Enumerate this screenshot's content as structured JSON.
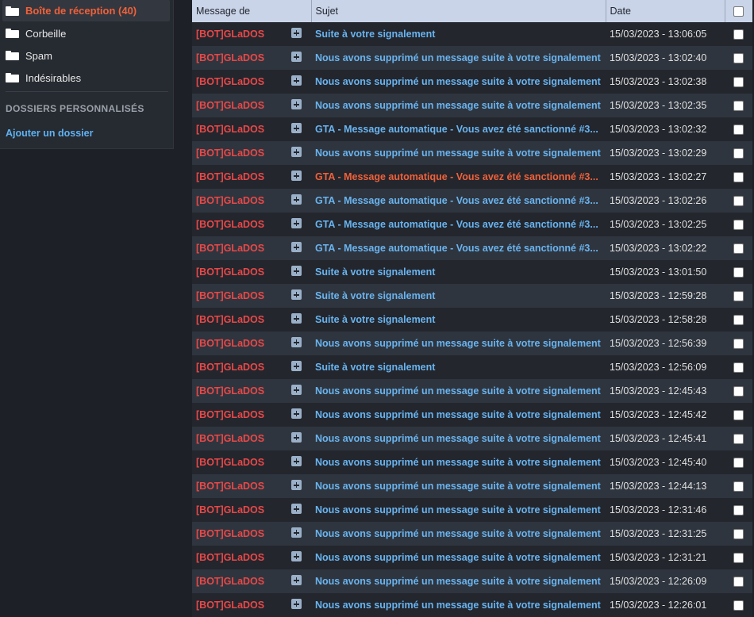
{
  "sidebar": {
    "folders": [
      {
        "label": "Boîte de réception (40)",
        "active": true
      },
      {
        "label": "Corbeille",
        "active": false
      },
      {
        "label": "Spam",
        "active": false
      },
      {
        "label": "Indésirables",
        "active": false
      }
    ],
    "custom_section_title": "DOSSIERS PERSONNALISÉS",
    "add_folder_label": "Ajouter un dossier"
  },
  "table": {
    "headers": {
      "from": "Message de",
      "subject": "Sujet",
      "date": "Date"
    },
    "rows": [
      {
        "from": "[BOT]GLaDOS",
        "subject": "Suite à votre signalement",
        "date": "15/03/2023 - 13:06:05",
        "alert": false
      },
      {
        "from": "[BOT]GLaDOS",
        "subject": "Nous avons supprimé un message suite à votre signalement",
        "date": "15/03/2023 - 13:02:40",
        "alert": false
      },
      {
        "from": "[BOT]GLaDOS",
        "subject": "Nous avons supprimé un message suite à votre signalement",
        "date": "15/03/2023 - 13:02:38",
        "alert": false
      },
      {
        "from": "[BOT]GLaDOS",
        "subject": "Nous avons supprimé un message suite à votre signalement",
        "date": "15/03/2023 - 13:02:35",
        "alert": false
      },
      {
        "from": "[BOT]GLaDOS",
        "subject": "GTA - Message automatique - Vous avez été sanctionné #3...",
        "date": "15/03/2023 - 13:02:32",
        "alert": false
      },
      {
        "from": "[BOT]GLaDOS",
        "subject": "Nous avons supprimé un message suite à votre signalement",
        "date": "15/03/2023 - 13:02:29",
        "alert": false
      },
      {
        "from": "[BOT]GLaDOS",
        "subject": "GTA - Message automatique - Vous avez été sanctionné #3...",
        "date": "15/03/2023 - 13:02:27",
        "alert": true
      },
      {
        "from": "[BOT]GLaDOS",
        "subject": "GTA - Message automatique - Vous avez été sanctionné #3...",
        "date": "15/03/2023 - 13:02:26",
        "alert": false
      },
      {
        "from": "[BOT]GLaDOS",
        "subject": "GTA - Message automatique - Vous avez été sanctionné #3...",
        "date": "15/03/2023 - 13:02:25",
        "alert": false
      },
      {
        "from": "[BOT]GLaDOS",
        "subject": "GTA - Message automatique - Vous avez été sanctionné #3...",
        "date": "15/03/2023 - 13:02:22",
        "alert": false
      },
      {
        "from": "[BOT]GLaDOS",
        "subject": "Suite à votre signalement",
        "date": "15/03/2023 - 13:01:50",
        "alert": false
      },
      {
        "from": "[BOT]GLaDOS",
        "subject": "Suite à votre signalement",
        "date": "15/03/2023 - 12:59:28",
        "alert": false
      },
      {
        "from": "[BOT]GLaDOS",
        "subject": "Suite à votre signalement",
        "date": "15/03/2023 - 12:58:28",
        "alert": false
      },
      {
        "from": "[BOT]GLaDOS",
        "subject": "Nous avons supprimé un message suite à votre signalement",
        "date": "15/03/2023 - 12:56:39",
        "alert": false
      },
      {
        "from": "[BOT]GLaDOS",
        "subject": "Suite à votre signalement",
        "date": "15/03/2023 - 12:56:09",
        "alert": false
      },
      {
        "from": "[BOT]GLaDOS",
        "subject": "Nous avons supprimé un message suite à votre signalement",
        "date": "15/03/2023 - 12:45:43",
        "alert": false
      },
      {
        "from": "[BOT]GLaDOS",
        "subject": "Nous avons supprimé un message suite à votre signalement",
        "date": "15/03/2023 - 12:45:42",
        "alert": false
      },
      {
        "from": "[BOT]GLaDOS",
        "subject": "Nous avons supprimé un message suite à votre signalement",
        "date": "15/03/2023 - 12:45:41",
        "alert": false
      },
      {
        "from": "[BOT]GLaDOS",
        "subject": "Nous avons supprimé un message suite à votre signalement",
        "date": "15/03/2023 - 12:45:40",
        "alert": false
      },
      {
        "from": "[BOT]GLaDOS",
        "subject": "Nous avons supprimé un message suite à votre signalement",
        "date": "15/03/2023 - 12:44:13",
        "alert": false
      },
      {
        "from": "[BOT]GLaDOS",
        "subject": "Nous avons supprimé un message suite à votre signalement",
        "date": "15/03/2023 - 12:31:46",
        "alert": false
      },
      {
        "from": "[BOT]GLaDOS",
        "subject": "Nous avons supprimé un message suite à votre signalement",
        "date": "15/03/2023 - 12:31:25",
        "alert": false
      },
      {
        "from": "[BOT]GLaDOS",
        "subject": "Nous avons supprimé un message suite à votre signalement",
        "date": "15/03/2023 - 12:31:21",
        "alert": false
      },
      {
        "from": "[BOT]GLaDOS",
        "subject": "Nous avons supprimé un message suite à votre signalement",
        "date": "15/03/2023 - 12:26:09",
        "alert": false
      },
      {
        "from": "[BOT]GLaDOS",
        "subject": "Nous avons supprimé un message suite à votre signalement",
        "date": "15/03/2023 - 12:26:01",
        "alert": false
      }
    ]
  },
  "colors": {
    "sender": "#e94848",
    "subject": "#69b4f0",
    "subject_alert": "#f0613a",
    "active_folder": "#f0613a",
    "header_bg": "#c9d4e8"
  },
  "icons": {
    "folder": "folder-icon",
    "expand": "plus-box-icon",
    "select": "checkbox"
  }
}
